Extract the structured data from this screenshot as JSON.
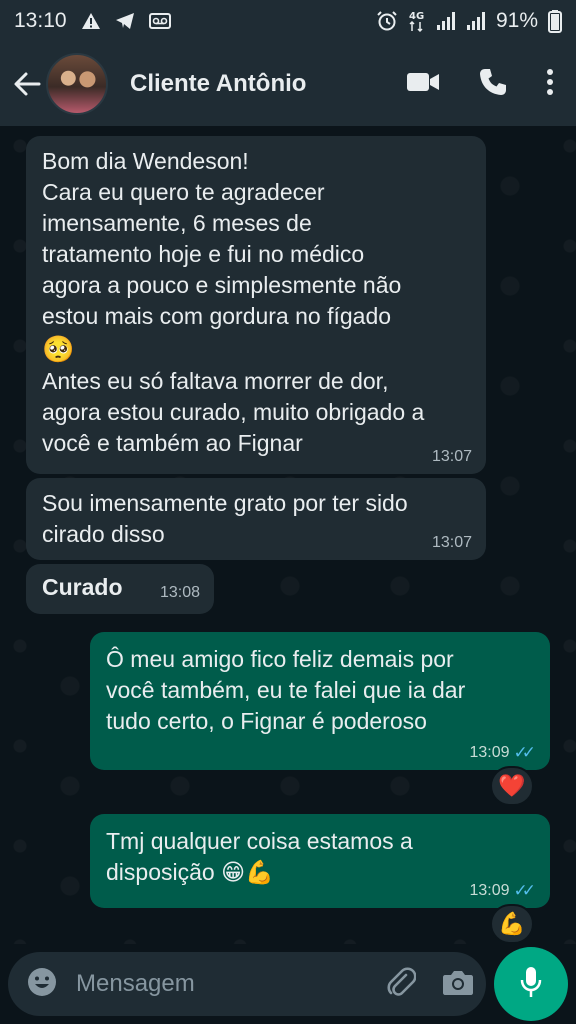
{
  "status_bar": {
    "time": "13:10",
    "left_icons": [
      "warning-icon",
      "telegram-icon",
      "voicemail-icon"
    ],
    "right_icons": [
      "alarm-icon",
      "4g-icon",
      "signal-icon",
      "signal-icon"
    ],
    "battery": "91%"
  },
  "header": {
    "contact_name": "Cliente Antônio",
    "icons": [
      "back-arrow-icon",
      "video-call-icon",
      "phone-icon",
      "more-vertical-icon"
    ]
  },
  "messages": [
    {
      "direction": "incoming",
      "lines": [
        "Bom dia Wendeson!",
        "Cara eu quero te agradecer",
        "imensamente, 6 meses de",
        "tratamento hoje e fui no médico",
        "agora a pouco e simplesmente não",
        "estou mais com gordura no fígado",
        "🥺",
        "Antes eu só faltava morrer de dor,",
        "agora estou curado, muito obrigado a",
        "você e também ao Fignar"
      ],
      "time": "13:07"
    },
    {
      "direction": "incoming",
      "lines": [
        "Sou imensamente grato por ter sido",
        "cirado disso"
      ],
      "time": "13:07"
    },
    {
      "direction": "incoming",
      "lines": [
        "Curado"
      ],
      "time": "13:08"
    },
    {
      "direction": "outgoing",
      "lines": [
        "Ô meu amigo fico feliz demais por",
        "você também, eu te falei que ia dar",
        "tudo certo, o Fignar é poderoso"
      ],
      "time": "13:09",
      "reaction": "❤️"
    },
    {
      "direction": "outgoing",
      "lines": [
        "Tmj qualquer coisa estamos a",
        "disposição 😁💪"
      ],
      "time": "13:09",
      "reaction": "💪"
    }
  ],
  "composer": {
    "placeholder": "Mensagem",
    "icons": [
      "emoji-icon",
      "attach-icon",
      "camera-icon",
      "mic-icon"
    ]
  },
  "colors": {
    "background": "#0b141a",
    "header": "#1f2c34",
    "incoming_bubble": "#202c33",
    "outgoing_bubble": "#005c4b",
    "accent": "#00a884",
    "read_ticks": "#53bdeb"
  }
}
